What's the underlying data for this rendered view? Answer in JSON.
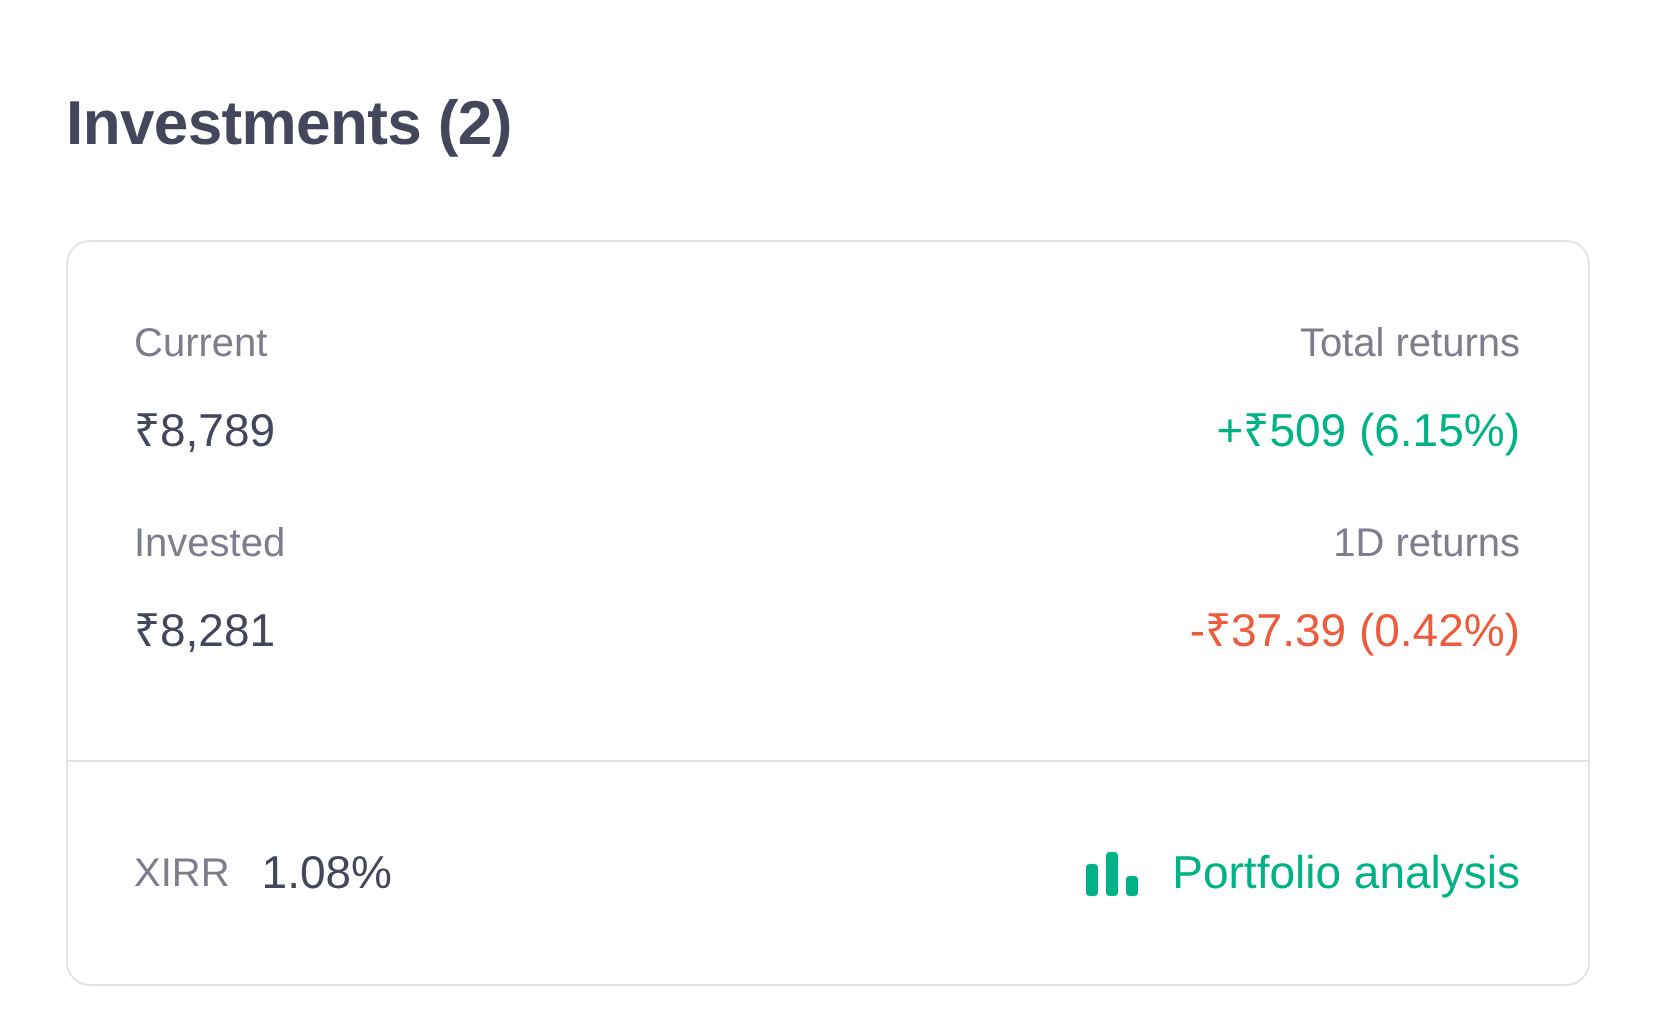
{
  "title": "Investments (2)",
  "stats": [
    {
      "label": "Current",
      "value": "₹8,789",
      "color": "#44475b"
    },
    {
      "label": "Total returns",
      "value": "+₹509 (6.15%)",
      "color": "#00b386"
    },
    {
      "label": "Invested",
      "value": "₹8,281",
      "color": "#44475b"
    },
    {
      "label": "1D returns",
      "value": "-₹37.39 (0.42%)",
      "color": "#eb5b3c"
    }
  ],
  "xirr": {
    "label": "XIRR",
    "value": "1.08%"
  },
  "analysis_link": {
    "label": "Portfolio analysis"
  }
}
